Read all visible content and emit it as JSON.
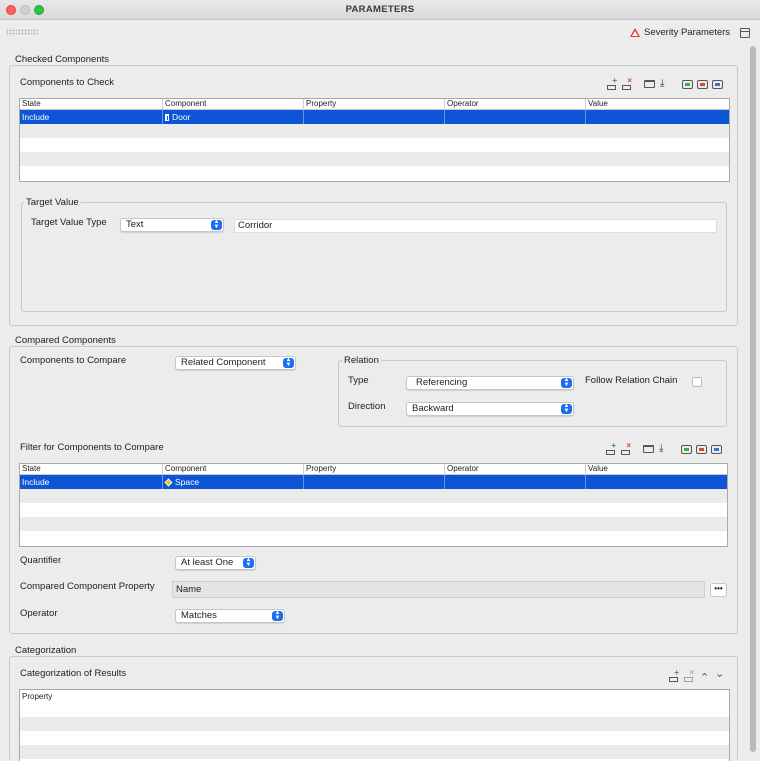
{
  "window": {
    "title": "PARAMETERS"
  },
  "header": {
    "severity_label": "Severity Parameters"
  },
  "checked": {
    "group_label": "Checked Components",
    "table_label": "Components to Check",
    "columns": [
      "State",
      "Component",
      "Property",
      "Operator",
      "Value"
    ],
    "rows": [
      {
        "state": "Include",
        "component": "Door",
        "property": "",
        "operator": "",
        "value": ""
      }
    ],
    "target": {
      "group_label": "Target Value",
      "type_label": "Target Value Type",
      "type_value": "Text",
      "value": "Corridor"
    }
  },
  "compared": {
    "group_label": "Compared Components",
    "compare_label": "Components to Compare",
    "compare_value": "Related Component",
    "relation": {
      "group_label": "Relation",
      "type_label": "Type",
      "type_value": "Referencing",
      "follow_label": "Follow Relation Chain",
      "follow_checked": false,
      "direction_label": "Direction",
      "direction_value": "Backward"
    },
    "filter_label": "Filter for Components to Compare",
    "columns": [
      "State",
      "Component",
      "Property",
      "Operator",
      "Value"
    ],
    "rows": [
      {
        "state": "Include",
        "component": "Space",
        "property": "",
        "operator": "",
        "value": ""
      }
    ],
    "quantifier_label": "Quantifier",
    "quantifier_value": "At least One",
    "property_label": "Compared Component Property",
    "property_value": "Name",
    "more_label": "•••",
    "operator_label": "Operator",
    "operator_value": "Matches"
  },
  "categorization": {
    "group_label": "Categorization",
    "table_label": "Categorization of Results",
    "columns": [
      "Property"
    ]
  },
  "colors": {
    "selection": "#0b55d6",
    "accent": "#1d6ef0",
    "warning": "#e3402a"
  },
  "icons": [
    "add-row-icon",
    "delete-row-icon",
    "folder-icon",
    "download-icon",
    "add-cup-icon",
    "remove-cup-icon",
    "edit-cup-icon",
    "move-up-icon",
    "move-down-icon",
    "severity-warning-icon",
    "panel-layout-icon"
  ]
}
